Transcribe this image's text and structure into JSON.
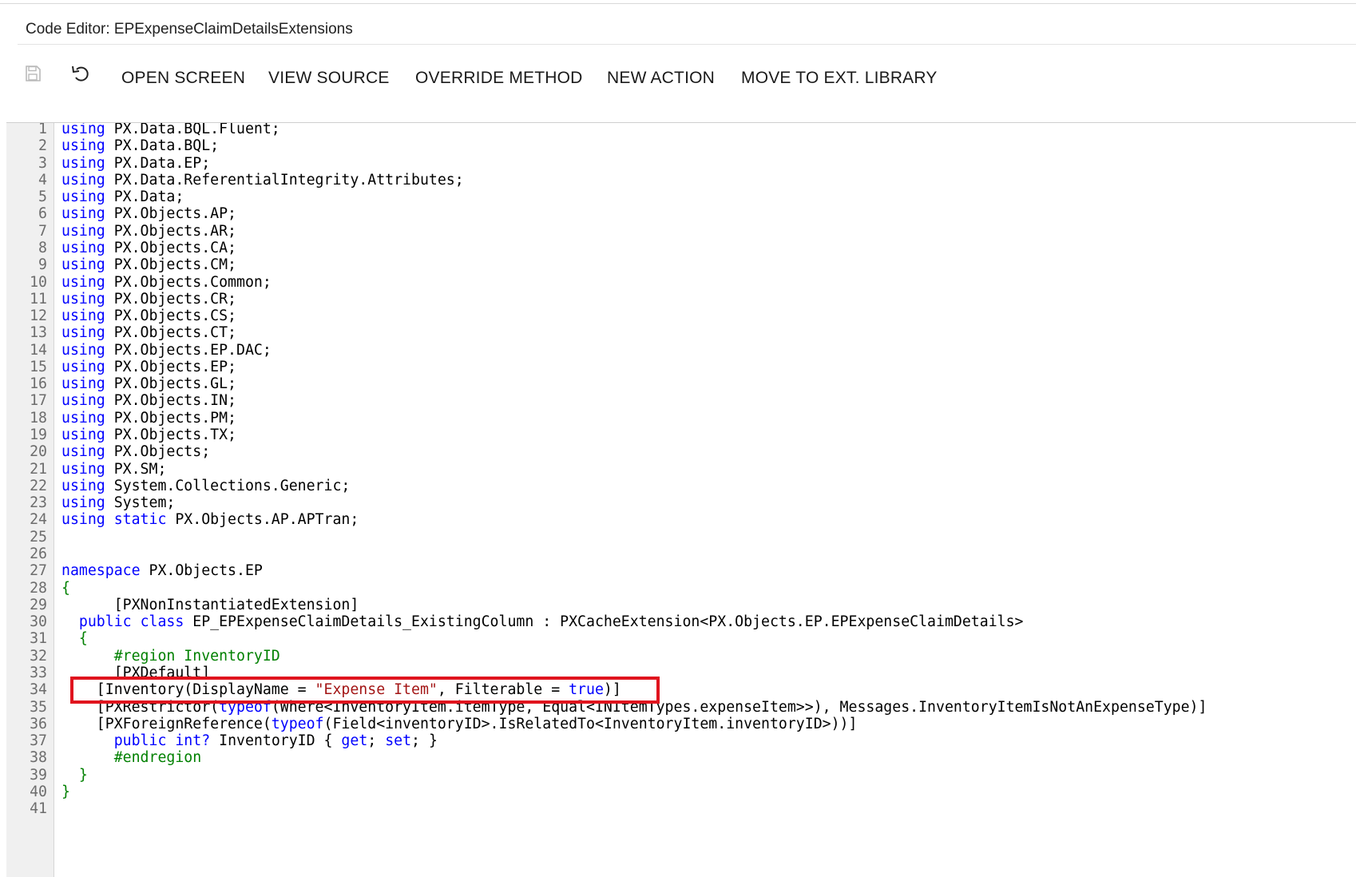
{
  "window": {
    "title": "Code Editor: EPExpenseClaimDetailsExtensions"
  },
  "toolbar": {
    "save_icon": "save-icon",
    "undo_icon": "undo-icon",
    "buttons": [
      {
        "label": "OPEN SCREEN"
      },
      {
        "label": "VIEW SOURCE"
      },
      {
        "label": "OVERRIDE METHOD"
      },
      {
        "label": "NEW ACTION"
      },
      {
        "label": "MOVE TO EXT. LIBRARY"
      }
    ]
  },
  "colors": {
    "keyword": "#0000ff",
    "string": "#a31515",
    "attribute": "#008000",
    "highlight": "#e0141e"
  },
  "editor": {
    "highlighted_line": 34,
    "lines": [
      {
        "n": "1",
        "tokens": [
          [
            "kw",
            "using"
          ],
          [
            "t",
            " PX.Data.BQL.Fluent;"
          ]
        ]
      },
      {
        "n": "2",
        "tokens": [
          [
            "kw",
            "using"
          ],
          [
            "t",
            " PX.Data.BQL;"
          ]
        ]
      },
      {
        "n": "3",
        "tokens": [
          [
            "kw",
            "using"
          ],
          [
            "t",
            " PX.Data.EP;"
          ]
        ]
      },
      {
        "n": "4",
        "tokens": [
          [
            "kw",
            "using"
          ],
          [
            "t",
            " PX.Data.ReferentialIntegrity.Attributes;"
          ]
        ]
      },
      {
        "n": "5",
        "tokens": [
          [
            "kw",
            "using"
          ],
          [
            "t",
            " PX.Data;"
          ]
        ]
      },
      {
        "n": "6",
        "tokens": [
          [
            "kw",
            "using"
          ],
          [
            "t",
            " PX.Objects.AP;"
          ]
        ]
      },
      {
        "n": "7",
        "tokens": [
          [
            "kw",
            "using"
          ],
          [
            "t",
            " PX.Objects.AR;"
          ]
        ]
      },
      {
        "n": "8",
        "tokens": [
          [
            "kw",
            "using"
          ],
          [
            "t",
            " PX.Objects.CA;"
          ]
        ]
      },
      {
        "n": "9",
        "tokens": [
          [
            "kw",
            "using"
          ],
          [
            "t",
            " PX.Objects.CM;"
          ]
        ]
      },
      {
        "n": "10",
        "tokens": [
          [
            "kw",
            "using"
          ],
          [
            "t",
            " PX.Objects.Common;"
          ]
        ]
      },
      {
        "n": "11",
        "tokens": [
          [
            "kw",
            "using"
          ],
          [
            "t",
            " PX.Objects.CR;"
          ]
        ]
      },
      {
        "n": "12",
        "tokens": [
          [
            "kw",
            "using"
          ],
          [
            "t",
            " PX.Objects.CS;"
          ]
        ]
      },
      {
        "n": "13",
        "tokens": [
          [
            "kw",
            "using"
          ],
          [
            "t",
            " PX.Objects.CT;"
          ]
        ]
      },
      {
        "n": "14",
        "tokens": [
          [
            "kw",
            "using"
          ],
          [
            "t",
            " PX.Objects.EP.DAC;"
          ]
        ]
      },
      {
        "n": "15",
        "tokens": [
          [
            "kw",
            "using"
          ],
          [
            "t",
            " PX.Objects.EP;"
          ]
        ]
      },
      {
        "n": "16",
        "tokens": [
          [
            "kw",
            "using"
          ],
          [
            "t",
            " PX.Objects.GL;"
          ]
        ]
      },
      {
        "n": "17",
        "tokens": [
          [
            "kw",
            "using"
          ],
          [
            "t",
            " PX.Objects.IN;"
          ]
        ]
      },
      {
        "n": "18",
        "tokens": [
          [
            "kw",
            "using"
          ],
          [
            "t",
            " PX.Objects.PM;"
          ]
        ]
      },
      {
        "n": "19",
        "tokens": [
          [
            "kw",
            "using"
          ],
          [
            "t",
            " PX.Objects.TX;"
          ]
        ]
      },
      {
        "n": "20",
        "tokens": [
          [
            "kw",
            "using"
          ],
          [
            "t",
            " PX.Objects;"
          ]
        ]
      },
      {
        "n": "21",
        "tokens": [
          [
            "kw",
            "using"
          ],
          [
            "t",
            " PX.SM;"
          ]
        ]
      },
      {
        "n": "22",
        "tokens": [
          [
            "kw",
            "using"
          ],
          [
            "t",
            " System.Collections.Generic;"
          ]
        ]
      },
      {
        "n": "23",
        "tokens": [
          [
            "kw",
            "using"
          ],
          [
            "t",
            " System;"
          ]
        ]
      },
      {
        "n": "24",
        "tokens": [
          [
            "kw",
            "using"
          ],
          [
            "t",
            " "
          ],
          [
            "kw",
            "static"
          ],
          [
            "t",
            " PX.Objects.AP.APTran;"
          ]
        ]
      },
      {
        "n": "25",
        "tokens": []
      },
      {
        "n": "26",
        "tokens": []
      },
      {
        "n": "27",
        "tokens": [
          [
            "kw",
            "namespace"
          ],
          [
            "t",
            " PX.Objects.EP"
          ]
        ]
      },
      {
        "n": "28",
        "tokens": [
          [
            "grn",
            "{"
          ]
        ]
      },
      {
        "n": "29",
        "tokens": [
          [
            "t",
            "      [PXNonInstantiatedExtension]"
          ]
        ]
      },
      {
        "n": "30",
        "tokens": [
          [
            "t",
            "  "
          ],
          [
            "kw",
            "public"
          ],
          [
            "t",
            " "
          ],
          [
            "kw",
            "class"
          ],
          [
            "t",
            " EP_EPExpenseClaimDetails_ExistingColumn : PXCacheExtension<PX.Objects.EP.EPExpenseClaimDetails>"
          ]
        ]
      },
      {
        "n": "31",
        "tokens": [
          [
            "grn",
            "  {"
          ]
        ]
      },
      {
        "n": "32",
        "tokens": [
          [
            "t",
            "      "
          ],
          [
            "grn",
            "#region InventoryID"
          ]
        ]
      },
      {
        "n": "33",
        "tokens": [
          [
            "t",
            "      [PXDefault]"
          ]
        ]
      },
      {
        "n": "34",
        "tokens": [
          [
            "t",
            "    [Inventory(DisplayName = "
          ],
          [
            "str",
            "\"Expense Item\""
          ],
          [
            "t",
            ", Filterable = "
          ],
          [
            "kw",
            "true"
          ],
          [
            "t",
            ")]"
          ]
        ]
      },
      {
        "n": "35",
        "tokens": [
          [
            "t",
            "    [PXRestrictor("
          ],
          [
            "kw",
            "typeof"
          ],
          [
            "t",
            "(Where<InventoryItem.itemType, Equal<INItemTypes.expenseItem>>), Messages.InventoryItemIsNotAnExpenseType)]"
          ]
        ]
      },
      {
        "n": "36",
        "tokens": [
          [
            "t",
            "    [PXForeignReference("
          ],
          [
            "kw",
            "typeof"
          ],
          [
            "t",
            "(Field<inventoryID>.IsRelatedTo<InventoryItem.inventoryID>))]"
          ]
        ]
      },
      {
        "n": "37",
        "tokens": [
          [
            "t",
            "      "
          ],
          [
            "kw",
            "public"
          ],
          [
            "t",
            " "
          ],
          [
            "kw",
            "int?"
          ],
          [
            "t",
            " InventoryID { "
          ],
          [
            "kw",
            "get"
          ],
          [
            "t",
            "; "
          ],
          [
            "kw",
            "set"
          ],
          [
            "t",
            "; }"
          ]
        ]
      },
      {
        "n": "38",
        "tokens": [
          [
            "t",
            "      "
          ],
          [
            "grn",
            "#endregion"
          ]
        ]
      },
      {
        "n": "39",
        "tokens": [
          [
            "grn",
            "  }"
          ]
        ]
      },
      {
        "n": "40",
        "tokens": [
          [
            "grn",
            "}"
          ]
        ]
      },
      {
        "n": "41",
        "tokens": []
      }
    ]
  }
}
